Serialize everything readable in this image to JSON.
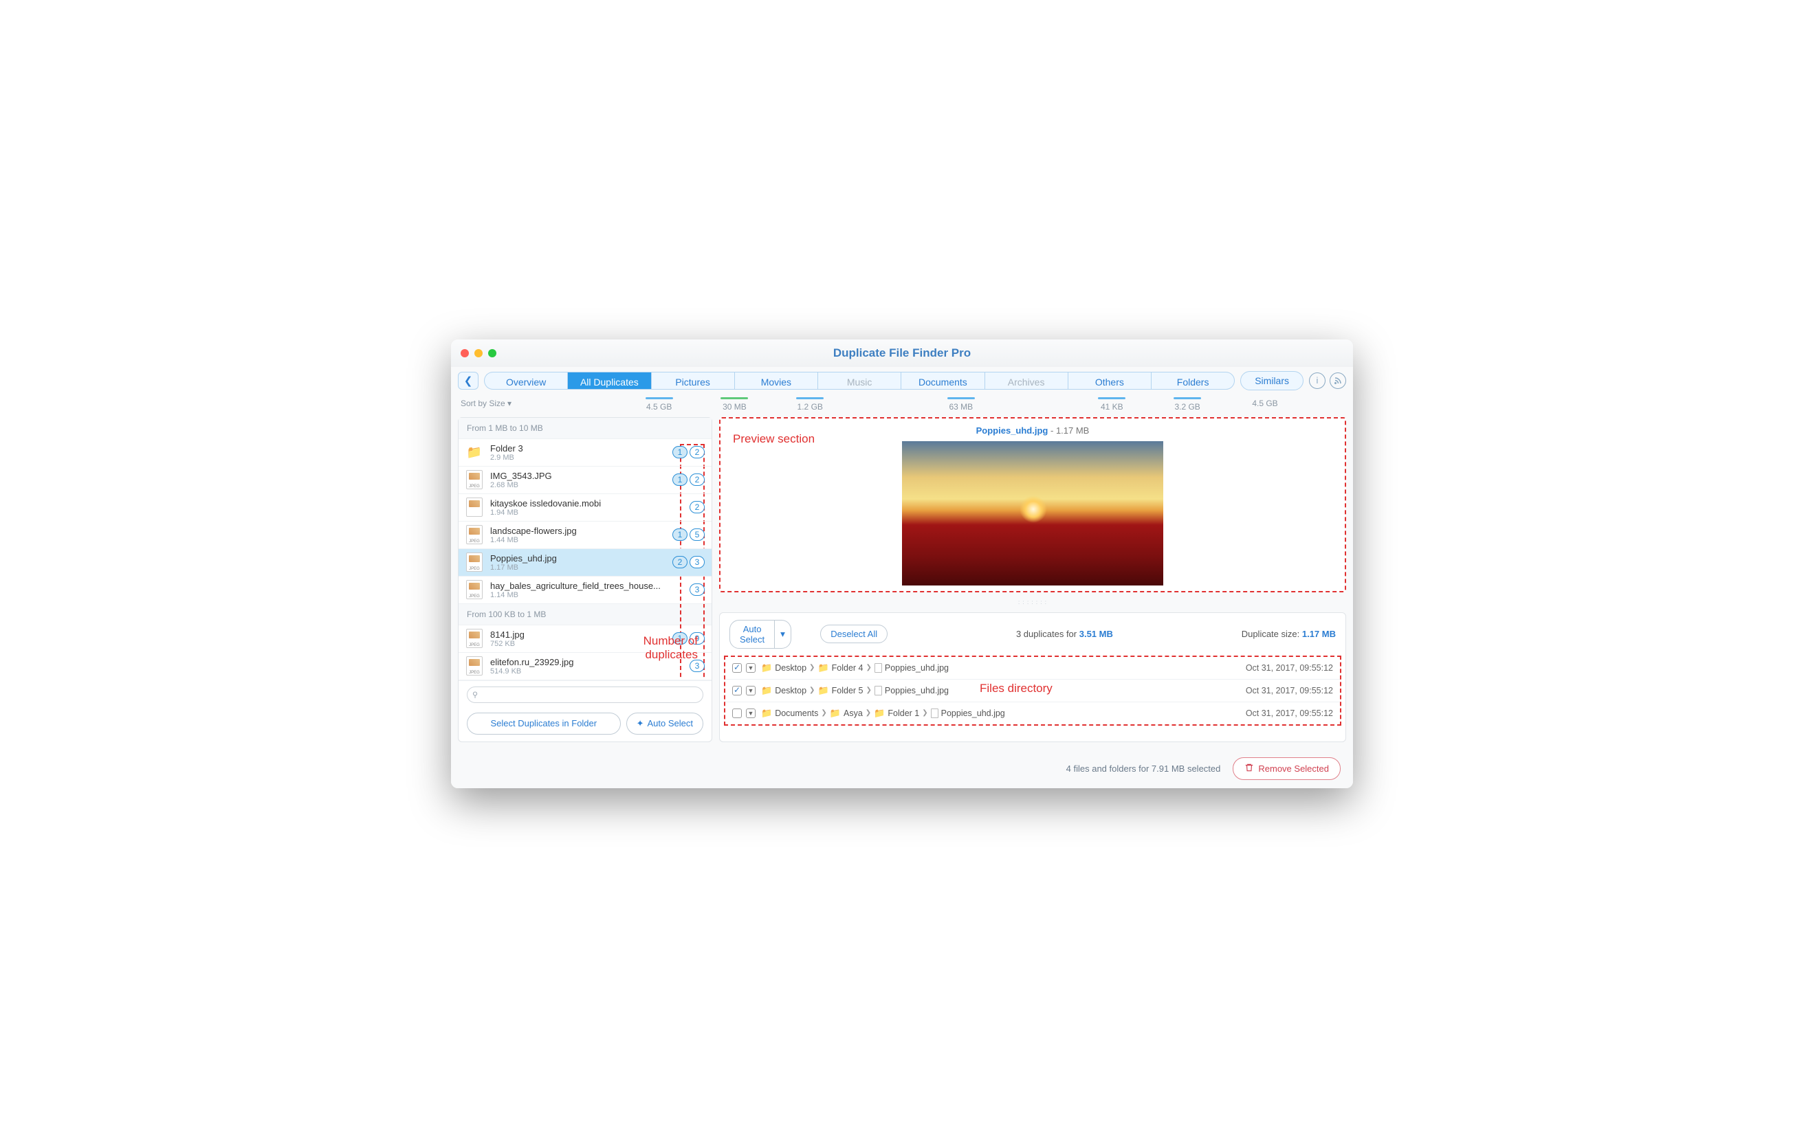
{
  "title": "Duplicate File Finder Pro",
  "tabs": [
    {
      "label": "Overview",
      "size": ""
    },
    {
      "label": "All Duplicates",
      "size": "4.5 GB",
      "active": true
    },
    {
      "label": "Pictures",
      "size": "30 MB"
    },
    {
      "label": "Movies",
      "size": "1.2 GB"
    },
    {
      "label": "Music",
      "size": "",
      "disabled": true
    },
    {
      "label": "Documents",
      "size": "63 MB"
    },
    {
      "label": "Archives",
      "size": "",
      "disabled": true
    },
    {
      "label": "Others",
      "size": "41 KB"
    },
    {
      "label": "Folders",
      "size": "3.2 GB"
    }
  ],
  "similars": {
    "label": "Similars",
    "size": "4.5 GB"
  },
  "sort_label": "Sort by Size ▾",
  "groups": [
    {
      "header": "From 1 MB to 10 MB",
      "items": [
        {
          "name": "Folder 3",
          "size": "2.9 MB",
          "icon": "folder",
          "sel": 1,
          "dup": 2
        },
        {
          "name": "IMG_3543.JPG",
          "size": "2.68 MB",
          "icon": "jpeg",
          "sel": 1,
          "dup": 2
        },
        {
          "name": "kitayskoe issledovanie.mobi",
          "size": "1.94 MB",
          "icon": "file",
          "sel": null,
          "dup": 2
        },
        {
          "name": "landscape-flowers.jpg",
          "size": "1.44 MB",
          "icon": "jpeg",
          "sel": 1,
          "dup": 5
        },
        {
          "name": "Poppies_uhd.jpg",
          "size": "1.17 MB",
          "icon": "jpeg",
          "sel": 2,
          "dup": 3,
          "selected": true
        },
        {
          "name": "hay_bales_agriculture_field_trees_house...",
          "size": "1.14 MB",
          "icon": "jpeg",
          "sel": null,
          "dup": 3
        }
      ]
    },
    {
      "header": "From 100 KB to 1 MB",
      "items": [
        {
          "name": "8141.jpg",
          "size": "752 KB",
          "icon": "jpeg",
          "sel": 1,
          "dup": 9
        },
        {
          "name": "elitefon.ru_23929.jpg",
          "size": "514.9 KB",
          "icon": "jpeg",
          "sel": null,
          "dup": 3
        }
      ]
    }
  ],
  "sidebar_buttons": {
    "select_folder": "Select Duplicates in Folder",
    "auto_select": "Auto Select"
  },
  "preview": {
    "filename": "Poppies_uhd.jpg",
    "size": "1.17 MB"
  },
  "dup_toolbar": {
    "auto_select": "Auto Select",
    "deselect": "Deselect All",
    "summary_pre": "3 duplicates for ",
    "summary_val": "3.51 MB",
    "right_pre": "Duplicate size: ",
    "right_val": "1.17 MB"
  },
  "paths": [
    {
      "checked": true,
      "segs": [
        "Desktop",
        "Folder 4",
        "Poppies_uhd.jpg"
      ],
      "date": "Oct 31, 2017, 09:55:12"
    },
    {
      "checked": true,
      "segs": [
        "Desktop",
        "Folder 5",
        "Poppies_uhd.jpg"
      ],
      "date": "Oct 31, 2017, 09:55:12"
    },
    {
      "checked": false,
      "segs": [
        "Documents",
        "Asya",
        "Folder 1",
        "Poppies_uhd.jpg"
      ],
      "date": "Oct 31, 2017, 09:55:12"
    }
  ],
  "footer": {
    "text": "4 files and folders for 7.91 MB selected",
    "remove": "Remove Selected"
  },
  "annotations": {
    "preview": "Preview section",
    "files_dir": "Files directory",
    "num_dup": "Number of\nduplicates"
  }
}
